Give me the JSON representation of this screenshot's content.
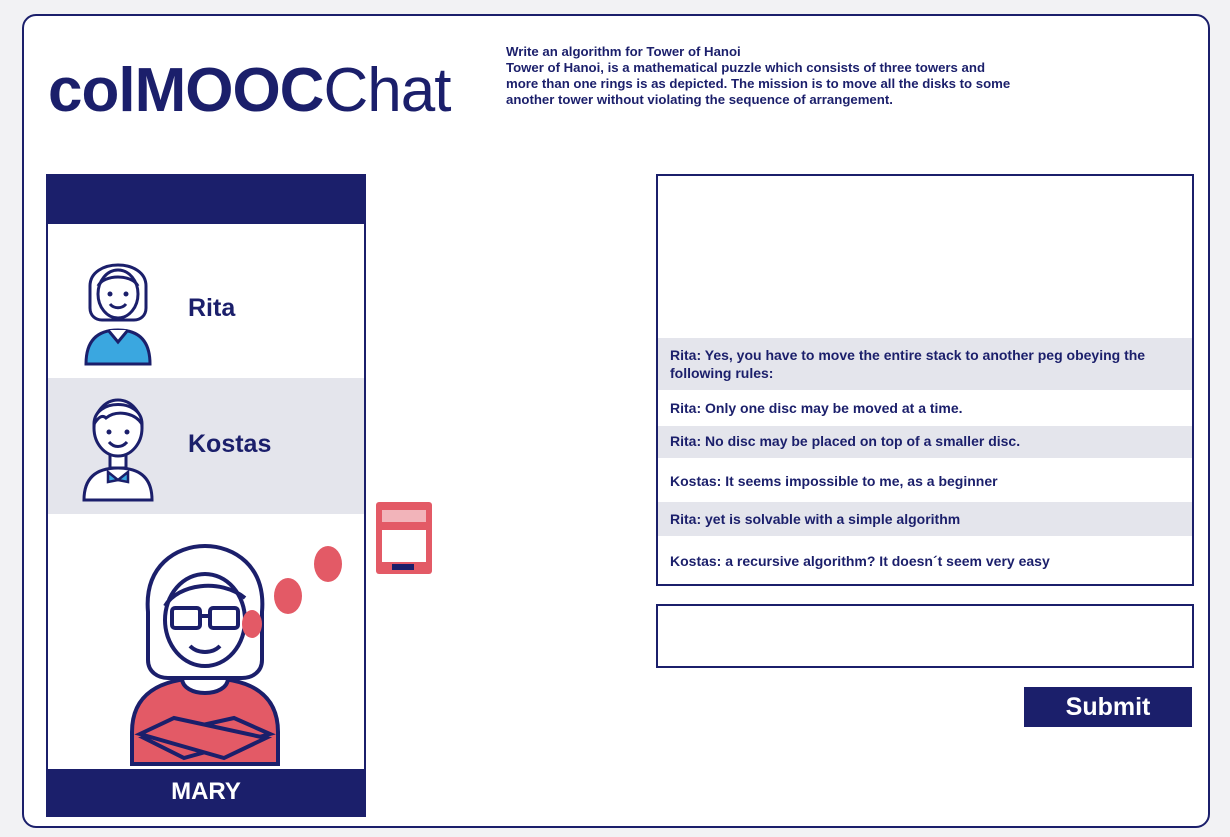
{
  "app": {
    "logo_bold": "colMOOC",
    "logo_light": "Chat"
  },
  "task": {
    "title": "Write an algorithm for Tower of Hanoi",
    "line1": "Tower of Hanoi, is a mathematical puzzle which consists of three towers and",
    "line2": "more than one rings is as depicted. The mission is to move all the disks to some",
    "line3": "another tower without violating the sequence of arrangement."
  },
  "users": {
    "list": [
      {
        "name": "Rita",
        "icon": "girl-avatar-icon"
      },
      {
        "name": "Kostas",
        "icon": "boy-avatar-icon"
      }
    ],
    "current_user": "MARY",
    "current_user_icon": "woman-glasses-avatar-icon"
  },
  "chat": {
    "messages": [
      {
        "author": "Rita:",
        "text": " Yes, you have to move the entire stack to another peg obeying the following rules:"
      },
      {
        "author": "Rita:",
        "text": " Only one disc may be moved at a time."
      },
      {
        "author": "Rita:",
        "text": " No disc may be placed on top of a smaller disc."
      },
      {
        "author": "Kostas:",
        "text": " It seems impossible to me, as a beginner"
      },
      {
        "author": "Rita:",
        "text": " yet is solvable with a simple algorithm"
      },
      {
        "author": "Kostas:",
        "text": " a recursive algorithm? It doesn´t seem very easy"
      }
    ],
    "input_value": "",
    "submit_label": "Submit"
  },
  "colors": {
    "primary": "#1b1f6b",
    "accent": "#e35a66",
    "shade": "#e4e5ec",
    "avatar_blue": "#3aa7e0"
  }
}
